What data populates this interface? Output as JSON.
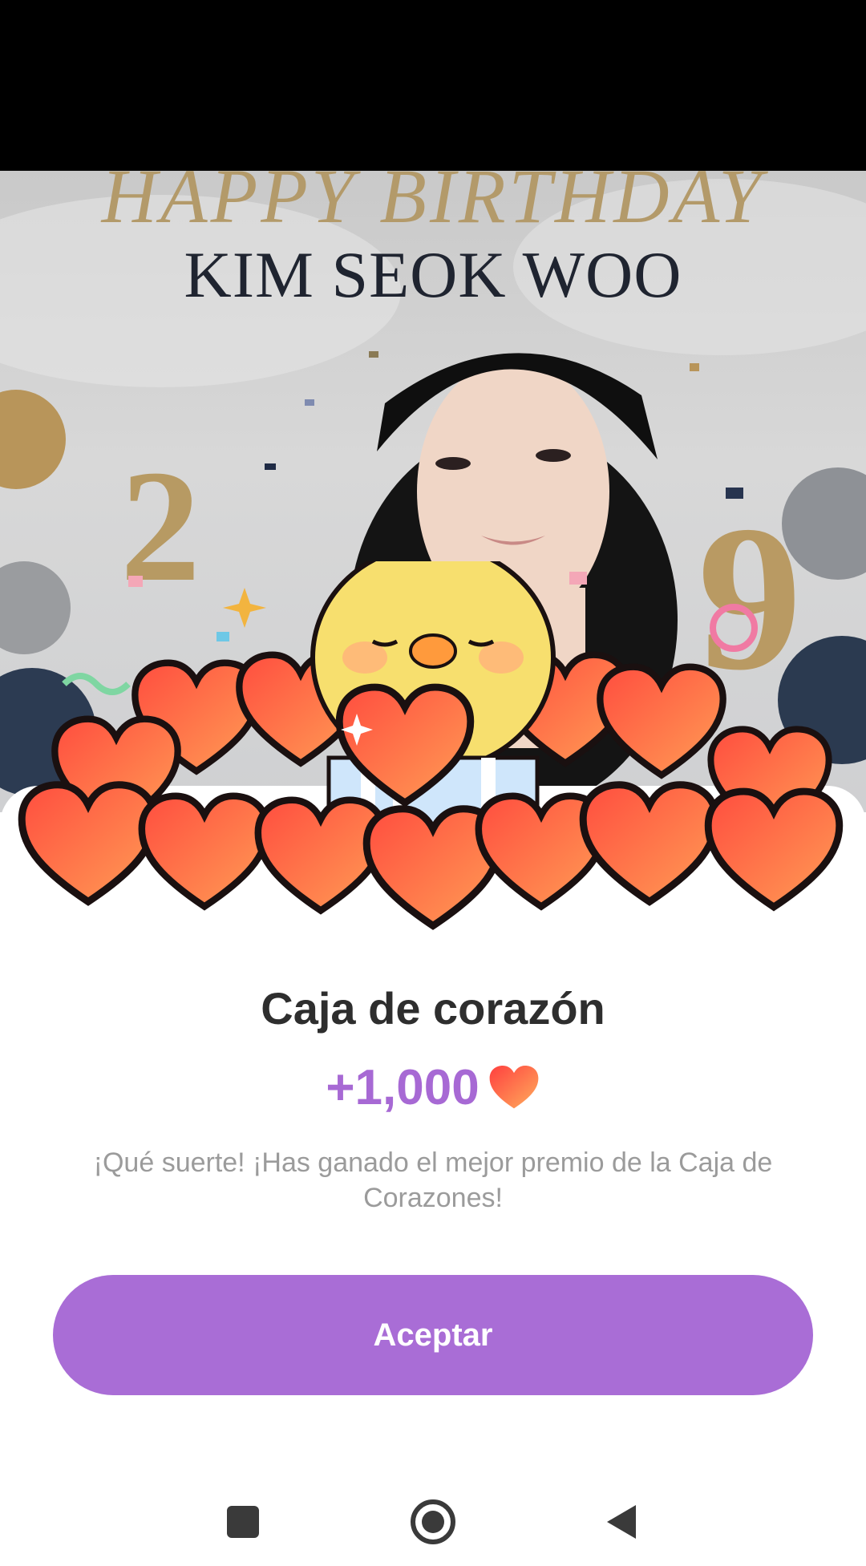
{
  "banner": {
    "line1": "HAPPY BIRTHDAY",
    "line2": "KIM SEOK WOO",
    "numbers": [
      "2",
      "9"
    ]
  },
  "dialog": {
    "title": "Caja de corazón",
    "amount": "+1,000",
    "amount_icon": "heart-icon",
    "message": "¡Qué suerte! ¡Has ganado el mejor premio de la Caja de Corazones!",
    "accept_label": "Aceptar"
  },
  "nav": {
    "icons": [
      "recents-square-icon",
      "home-circle-icon",
      "back-triangle-icon"
    ]
  },
  "colors": {
    "accent": "#a96dd6",
    "amount": "#a769d4",
    "heart": "#ff6a45",
    "text": "#2e2e2e",
    "muted": "#9b9b9b"
  }
}
